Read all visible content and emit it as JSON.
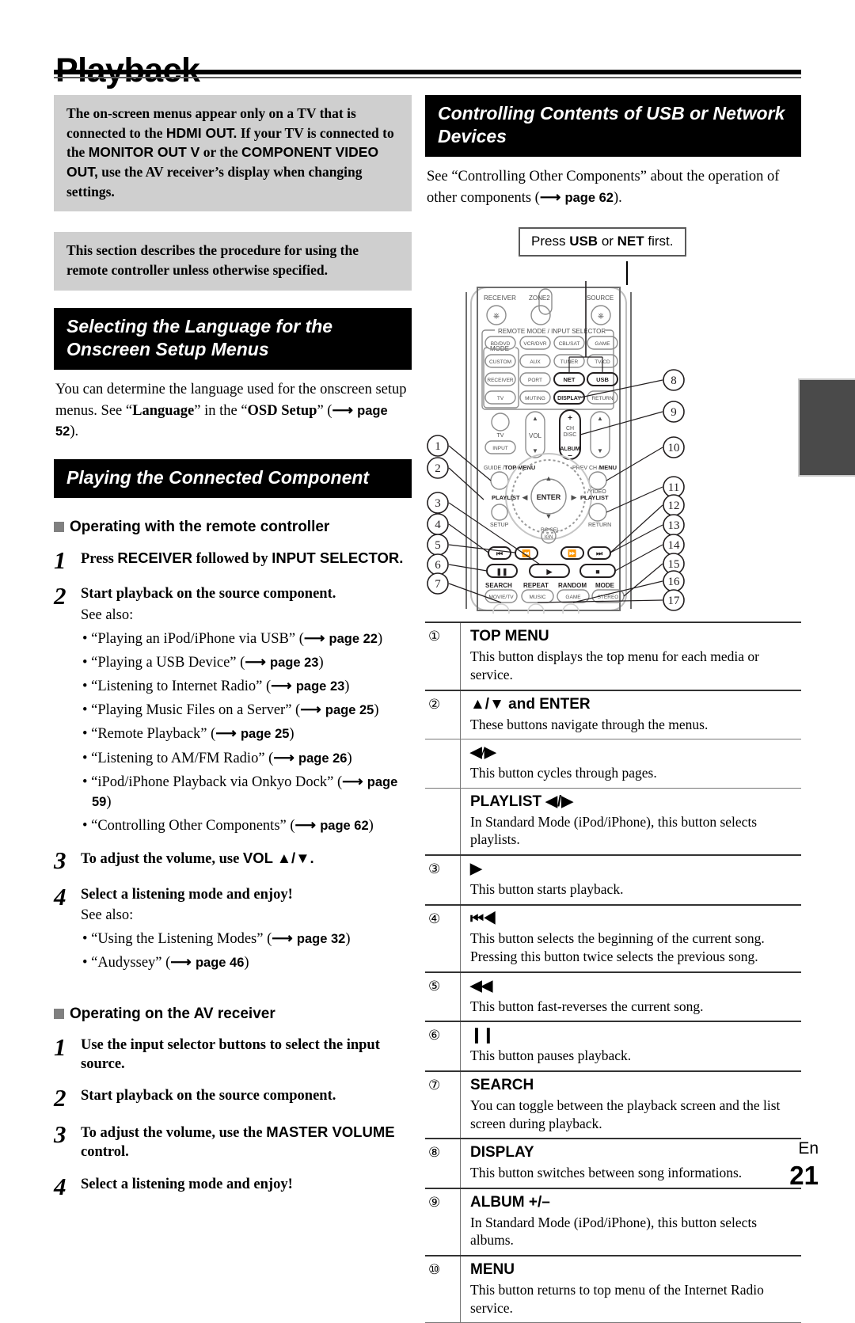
{
  "page": {
    "title": "Playback",
    "language_code": "En",
    "number": "21"
  },
  "left_column": {
    "note_1": {
      "text_parts": [
        {
          "t": "The on-screen menus appear only on a TV that is connected to the ",
          "s": false
        },
        {
          "t": "HDMI OUT.",
          "s": true
        },
        {
          "t": " If your TV is connected to the ",
          "s": false
        },
        {
          "t": "MONITOR OUT V",
          "s": true
        },
        {
          "t": " or the ",
          "s": false
        },
        {
          "t": "COMPONENT VIDEO OUT,",
          "s": true
        },
        {
          "t": " use the AV receiver’s display when changing settings.",
          "s": false
        }
      ]
    },
    "note_2": {
      "text": "This section describes the procedure for using the remote controller unless otherwise specified."
    },
    "heading_language": "Selecting the Language for the Onscreen Setup Menus",
    "language_para": {
      "lead": "You can determine the language used for the onscreen setup menus. See “",
      "bold_1": "Language",
      "mid": "” in the “",
      "bold_2": "OSD Setup",
      "tail": "” (",
      "page_ref": "page 52",
      "end": ")."
    },
    "heading_playing": "Playing the Connected Component",
    "subhead_remote": "Operating with the remote controller",
    "subhead_receiver": "Operating on the AV receiver",
    "steps_remote": [
      {
        "num": "1",
        "title_parts": [
          {
            "t": "Press ",
            "s": false
          },
          {
            "t": "RECEIVER",
            "s": true
          },
          {
            "t": " followed by ",
            "s": false
          },
          {
            "t": "INPUT SELECTOR.",
            "s": true
          }
        ],
        "see_also": "",
        "bullets": []
      },
      {
        "num": "2",
        "title_parts": [
          {
            "t": "Start playback on the source component.",
            "s": false
          }
        ],
        "see_also": "See also:",
        "bullets": [
          {
            "text": "• “Playing an iPod/iPhone via USB” (",
            "page": "page 22",
            "end": ")"
          },
          {
            "text": "• “Playing a USB Device” (",
            "page": "page 23",
            "end": ")"
          },
          {
            "text": "• “Listening to Internet Radio” (",
            "page": "page 23",
            "end": ")"
          },
          {
            "text": "• “Playing Music Files on a Server” (",
            "page": "page 25",
            "end": ")"
          },
          {
            "text": "• “Remote Playback” (",
            "page": "page 25",
            "end": ")"
          },
          {
            "text": "• “Listening to AM/FM Radio” (",
            "page": "page 26",
            "end": ")"
          },
          {
            "text": "• “iPod/iPhone Playback via Onkyo Dock” (",
            "page": "page 59",
            "end": ")"
          },
          {
            "text": "• “Controlling Other Components” (",
            "page": "page 62",
            "end": ")"
          }
        ]
      },
      {
        "num": "3",
        "title_parts": [
          {
            "t": "To adjust the volume, use ",
            "s": false
          },
          {
            "t": "VOL ▲/▼.",
            "s": true
          }
        ],
        "see_also": "",
        "bullets": []
      },
      {
        "num": "4",
        "title_parts": [
          {
            "t": "Select a listening mode and enjoy!",
            "s": false
          }
        ],
        "see_also": "See also:",
        "bullets": [
          {
            "text": "• “Using the Listening Modes” (",
            "page": "page 32",
            "end": ")"
          },
          {
            "text": "• “Audyssey” (",
            "page": "page 46",
            "end": ")"
          }
        ]
      }
    ],
    "steps_receiver": [
      {
        "num": "1",
        "title_parts": [
          {
            "t": "Use the input selector buttons to select the input source.",
            "s": false
          }
        ]
      },
      {
        "num": "2",
        "title_parts": [
          {
            "t": "Start playback on the source component.",
            "s": false
          }
        ]
      },
      {
        "num": "3",
        "title_parts": [
          {
            "t": "To adjust the volume, use the ",
            "s": false
          },
          {
            "t": "MASTER VOLUME",
            "s": true
          },
          {
            "t": " control.",
            "s": false
          }
        ]
      },
      {
        "num": "4",
        "title_parts": [
          {
            "t": "Select a listening mode and enjoy!",
            "s": false
          }
        ]
      }
    ]
  },
  "right_column": {
    "heading_usb": "Controlling Contents of USB or Network Devices",
    "intro": {
      "lead": "See “Controlling Other Components” about the operation of other components (",
      "page_ref": "page 62",
      "end": ")."
    },
    "press_box": {
      "pre": "Press ",
      "key_1": "USB",
      "mid": " or ",
      "key_2": "NET",
      "post": " first."
    },
    "remote": {
      "group_labels": {
        "remote_mode": "REMOTE MODE / INPUT SELECTOR",
        "mode": "MODE"
      },
      "top_labels": [
        "RECEIVER",
        "ZONE2",
        "SOURCE"
      ],
      "input_buttons": [
        [
          "BD/DVD",
          "VCR/DVR",
          "CBL/SAT",
          "GAME"
        ],
        [
          "CUSTOM",
          "AUX",
          "TUNER",
          "TV/CD"
        ],
        [
          "RECEIVER",
          "PORT",
          "NET",
          "USB"
        ],
        [
          "TV",
          "MUTING",
          "DISPLAY",
          "RETURN"
        ]
      ],
      "dial_labels": {
        "top_menu": "GUIDE / TOP MENU",
        "menu": "PREV CH / MENU",
        "enter": "ENTER",
        "playlist_left": "PLAYLIST",
        "playlist_right": "PLAYLIST",
        "setup": "SETUP",
        "return": "RETURN",
        "video": "/VIDEO",
        "vol": "VOL",
        "ch_disc": "CH DISC",
        "album": "ALBUM",
        "tv": "TV",
        "input": "INPUT"
      },
      "transport_labels": [
        "SEARCH",
        "REPEAT",
        "RANDOM",
        "MODE"
      ],
      "mode_buttons": [
        "MOVIE/TV",
        "MUSIC",
        "GAME",
        "STEREO"
      ],
      "callouts_left": [
        "1",
        "2",
        "3",
        "4",
        "5",
        "6",
        "7"
      ],
      "callouts_right": [
        "8",
        "9",
        "10",
        "11",
        "12",
        "13",
        "14",
        "15",
        "16",
        "17"
      ]
    },
    "descriptions": [
      {
        "num": "①",
        "label": "TOP MENU",
        "symbol": "",
        "text": "This button displays the top menu for each media or service.",
        "thick": true
      },
      {
        "num": "②",
        "label": "▲/▼ and ENTER",
        "symbol": "",
        "text": "These buttons navigate through the menus.",
        "thick": false
      },
      {
        "num": "",
        "label": "",
        "symbol": "◀/▶",
        "text": "This button cycles through pages.",
        "thick": false
      },
      {
        "num": "",
        "label": "PLAYLIST ◀/▶",
        "symbol": "",
        "text": "In Standard Mode (iPod/iPhone), this button selects playlists.",
        "thick": true
      },
      {
        "num": "③",
        "label": "",
        "symbol": "▶",
        "text": "This button starts playback.",
        "thick": true
      },
      {
        "num": "④",
        "label": "",
        "symbol": "⏮◀",
        "text": "This button selects the beginning of the current song. Pressing this button twice selects the previous song.",
        "thick": true
      },
      {
        "num": "⑤",
        "label": "",
        "symbol": "◀◀",
        "text": "This button fast-reverses the current song.",
        "thick": true
      },
      {
        "num": "⑥",
        "label": "",
        "symbol": "❙❙",
        "text": "This button pauses playback.",
        "thick": true
      },
      {
        "num": "⑦",
        "label": "SEARCH",
        "symbol": "",
        "text": "You can toggle between the playback screen and the list screen during playback.",
        "thick": true
      },
      {
        "num": "⑧",
        "label": "DISPLAY",
        "symbol": "",
        "text": "This button switches between song informations.",
        "thick": true
      },
      {
        "num": "⑨",
        "label": "ALBUM +/–",
        "symbol": "",
        "text": "In Standard Mode (iPod/iPhone), this button selects albums.",
        "thick": true
      },
      {
        "num": "⑩",
        "label": "MENU",
        "symbol": "",
        "text": "This button returns to top menu of the Internet Radio service.",
        "thick": false
      }
    ]
  }
}
